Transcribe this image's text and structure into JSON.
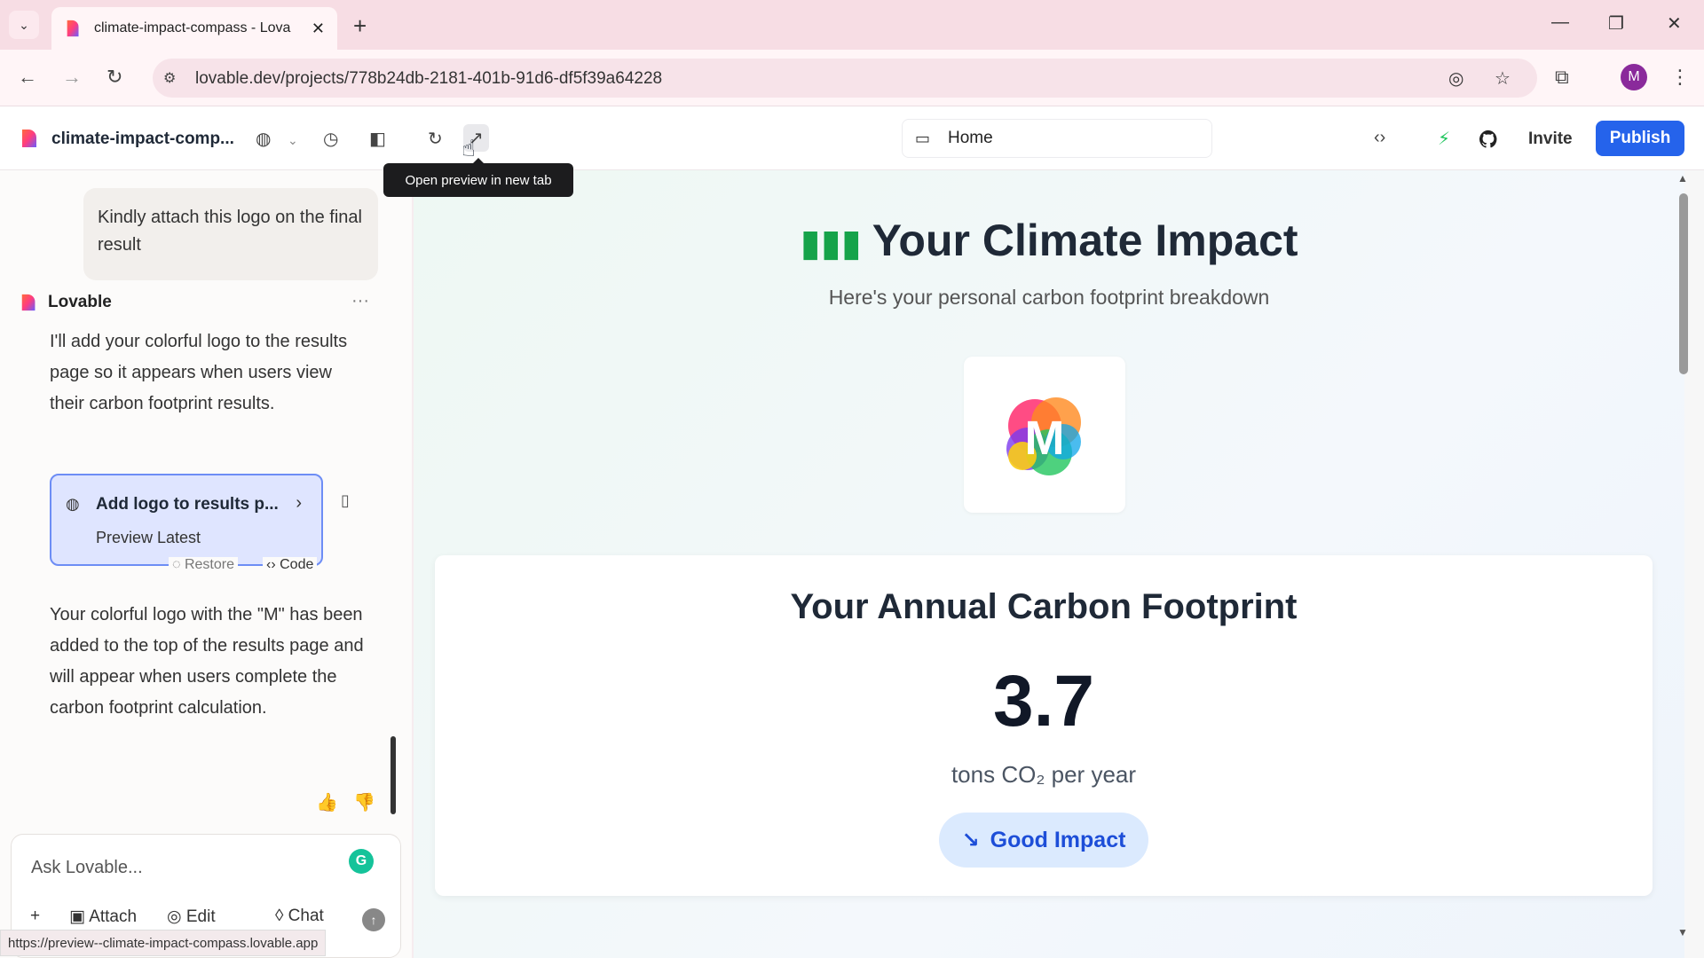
{
  "browser": {
    "tab_title": "climate-impact-compass - Lova",
    "url": "lovable.dev/projects/778b24db-2181-401b-91d6-df5f39a64228",
    "profile_initial": "M",
    "status_url": "https://preview--climate-impact-compass.lovable.app"
  },
  "app_header": {
    "project_name": "climate-impact-comp...",
    "route_label": "Home",
    "invite_label": "Invite",
    "publish_label": "Publish",
    "tooltip": "Open preview in new tab"
  },
  "chat": {
    "user_message": "Kindly attach this logo on the final result",
    "assistant_name": "Lovable",
    "assistant_message_1": "I'll add your colorful logo to the results page so it appears when users view their carbon footprint results.",
    "change_card": {
      "title": "Add logo to results p...",
      "subtitle": "Preview Latest",
      "restore_label": "Restore",
      "code_label": "Code"
    },
    "assistant_message_2": "Your colorful logo with the \"M\" has been added to the top of the results page and will appear when users complete the carbon footprint calculation.",
    "input_placeholder": "Ask Lovable...",
    "tools": {
      "attach": "Attach",
      "edit": "Edit",
      "chat": "Chat"
    }
  },
  "preview": {
    "title": "Your Climate Impact",
    "subtitle": "Here's your personal carbon footprint breakdown",
    "logo_letter": "M",
    "card_title": "Your Annual Carbon Footprint",
    "value": "3.7",
    "unit": "tons CO₂ per year",
    "badge": "Good Impact"
  },
  "colors": {
    "publish": "#2563eb",
    "accent_green": "#16a34a",
    "badge_text": "#1d4ed8",
    "badge_bg": "#dbeafe",
    "tabbar": "#f7dde4"
  }
}
